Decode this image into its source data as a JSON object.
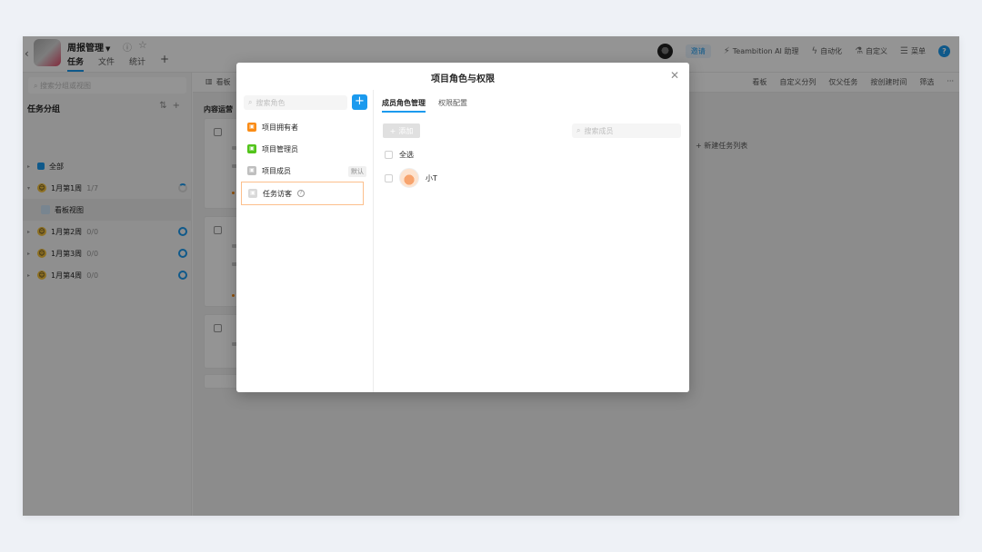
{
  "header": {
    "project_title": "周报管理",
    "tabs": [
      "任务",
      "文件",
      "统计"
    ],
    "invite": "邀请",
    "ai_assistant": "Teambition AI 助理",
    "automation": "自动化",
    "customize": "自定义",
    "menu": "菜单"
  },
  "left_panel": {
    "search_placeholder": "搜索分组或视图",
    "title": "任务分组",
    "groups": [
      {
        "label": "全部",
        "count": ""
      },
      {
        "label": "1月第1周",
        "count": "1/7"
      },
      {
        "label": "看板视图",
        "count": ""
      },
      {
        "label": "1月第2周",
        "count": "0/0"
      },
      {
        "label": "1月第3周",
        "count": "0/0"
      },
      {
        "label": "1月第4周",
        "count": "0/0"
      }
    ]
  },
  "board": {
    "view_tab": "看板",
    "toolbar_right": [
      "看板",
      "自定义分列",
      "仅父任务",
      "按创建时间",
      "筛选"
    ],
    "column_title": "内容运营",
    "new_list": "新建任务列表"
  },
  "modal": {
    "title": "项目角色与权限",
    "role_search_placeholder": "搜索角色",
    "roles": [
      {
        "label": "项目拥有者",
        "color": "#fa8c16"
      },
      {
        "label": "项目管理员",
        "color": "#52c41a"
      },
      {
        "label": "项目成员",
        "color": "#bfbfbf",
        "badge": "默认"
      },
      {
        "label": "任务访客",
        "color": "#d9d9d9"
      }
    ],
    "tabs": [
      "成员角色管理",
      "权限配置"
    ],
    "add_button": "添加",
    "member_search_placeholder": "搜索成员",
    "select_all": "全选",
    "members": [
      {
        "name": "小T"
      }
    ]
  }
}
